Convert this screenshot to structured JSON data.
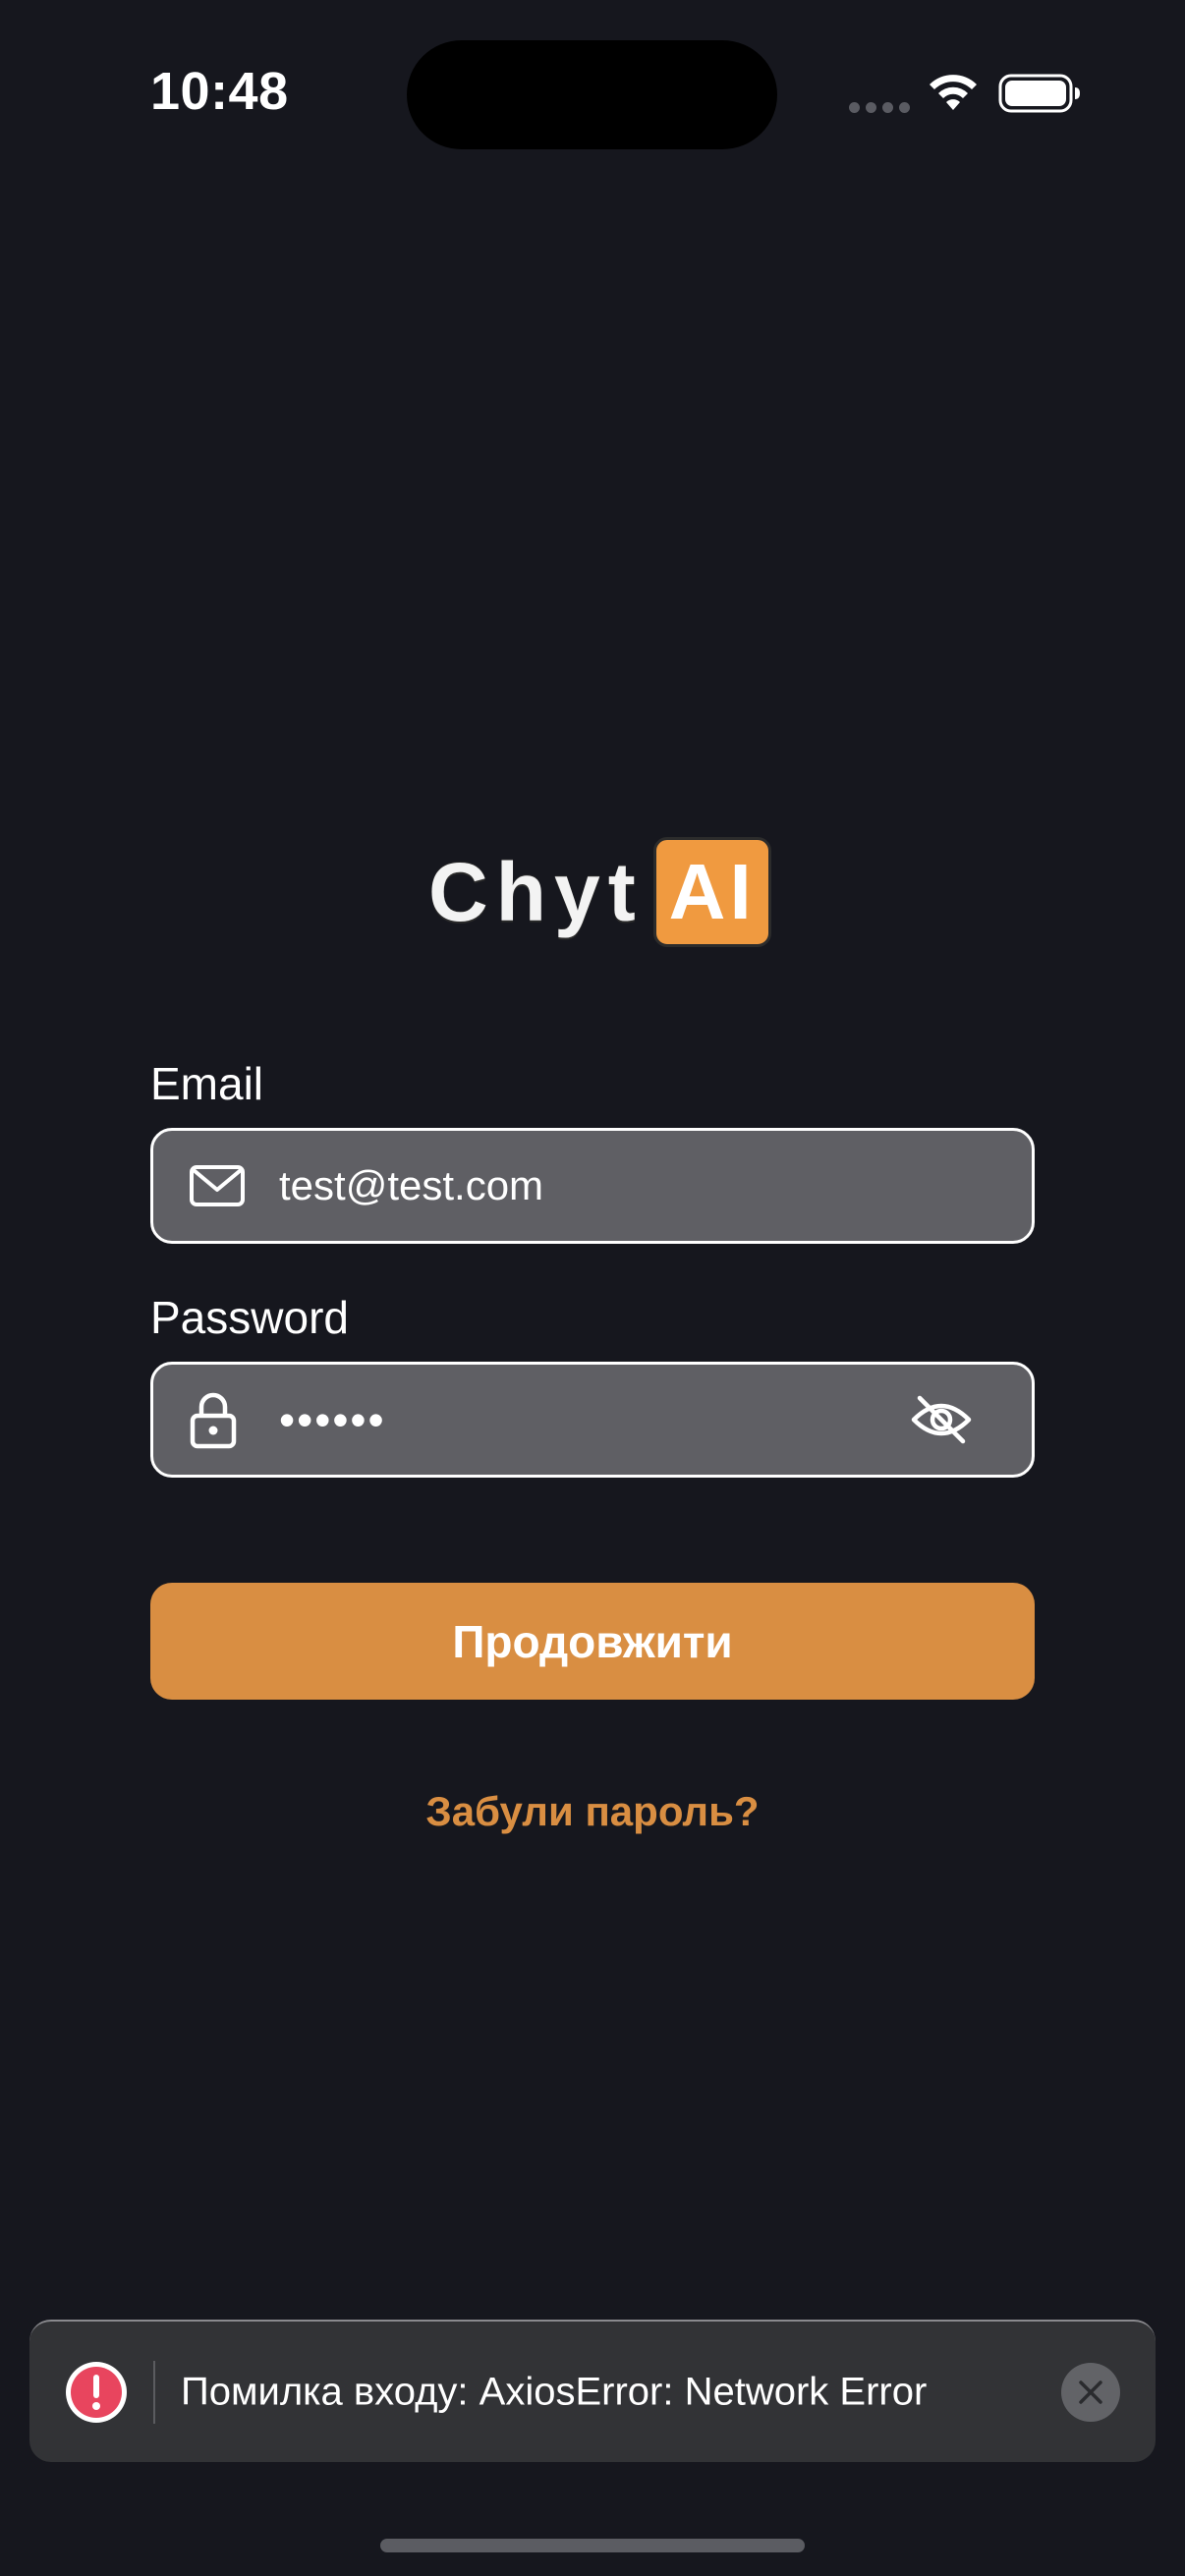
{
  "status_bar": {
    "time": "10:48",
    "icons": [
      "signal-dots-icon",
      "wifi-icon",
      "battery-icon"
    ]
  },
  "logo": {
    "text": "Chyt",
    "badge": "AI",
    "badge_color": "#f09a40"
  },
  "form": {
    "email_label": "Email",
    "email_value": "test@test.com",
    "email_icon": "mail-icon",
    "password_label": "Password",
    "password_value": "••••••",
    "password_icon": "lock-icon",
    "visibility_icon": "eye-off-icon",
    "submit_label": "Продовжити",
    "forgot_label": "Забули пароль?"
  },
  "toast": {
    "message": "Помилка входу: AxiosError: Network Error",
    "icon": "alert-icon",
    "close_icon": "close-icon",
    "alert_color": "#e8455e"
  },
  "colors": {
    "background": "#16171e",
    "accent": "#d98e42",
    "input_bg": "#5f5f64"
  }
}
